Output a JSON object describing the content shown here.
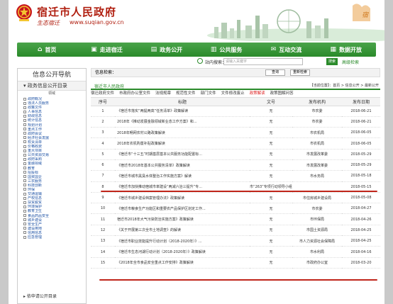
{
  "header": {
    "site_title": "宿迁市人民政府",
    "slogan": "生态宿迁",
    "url": "www.suqian.gov.cn"
  },
  "nav": [
    {
      "label": "首页",
      "icon": "home-icon"
    },
    {
      "label": "走进宿迁",
      "icon": "screen-icon"
    },
    {
      "label": "政务公开",
      "icon": "document-icon"
    },
    {
      "label": "公共服务",
      "icon": "service-icon"
    },
    {
      "label": "互动交流",
      "icon": "chat-icon"
    },
    {
      "label": "数据开放",
      "icon": "data-icon"
    }
  ],
  "search": {
    "label": "站内搜索：",
    "placeholder": "请输入关键字",
    "button": "搜索",
    "advanced": "高级检索"
  },
  "left": {
    "title": "信息公开导航",
    "category": "政务信息公开目录",
    "sub_header": "领域",
    "items": [
      "政府概况",
      "违法人员服务",
      "政策文件",
      "人事信息",
      "财政信息",
      "统计信息",
      "规划计划",
      "重点工作",
      "政府会议",
      "经济社会发展",
      "权责清单",
      "价格收费",
      "重大项目",
      "公共资源交易",
      "政府采购",
      "金融领域",
      "教育",
      "招投标",
      "国资国企",
      "三农服务",
      "科技创新",
      "环保",
      "交通运输",
      "产权信息",
      "扶贫脱贫",
      "环境保护",
      "教育卫生",
      "食品药品安全",
      "城乡建设",
      "安全生产",
      "建设用地",
      "信用信息",
      "应急管理"
    ],
    "category2": "依申请公开目录"
  },
  "right": {
    "retrieval_label": "信息检索：",
    "query_button": "查询",
    "reset_button": "重新检索",
    "tab_title": "宿迁市人民政府",
    "breadcrumb": "【当前位置】：首页 > 信息公开 > 最新公开",
    "tabs": [
      "宿迁政府文件",
      "市政府办公室文件",
      "法规规章",
      "规范性文件",
      "部门文件",
      "文件修改废止",
      "政策解读",
      "政策图解问答"
    ],
    "active_tab_index": 6,
    "columns": [
      "序号",
      "标题",
      "文号",
      "发布机构",
      "发布日期"
    ],
    "rows": [
      [
        "1",
        "《宿迁市落实“两提两高”任务清单》政策解读",
        "无",
        "市农委",
        "2018-06-21"
      ],
      [
        "2",
        "2018年《推动发展金融领域新业态工作方案》和...",
        "无",
        "市农委",
        "2018-06-21"
      ],
      [
        "3",
        "2018年畅网农村公路政策解读",
        "无",
        "市农机局",
        "2018-06-05"
      ],
      [
        "4",
        "2018年农机购置补贴政策解读",
        "无",
        "市农机局",
        "2018-06-05"
      ],
      [
        "5",
        "《宿迁市“十三五”时期基层基本公共服务功能配置标...",
        "无",
        "市发展改革委",
        "2018-05-29"
      ],
      [
        "6",
        "《宿迁市2018年基本公共服务清单》政策解读",
        "无",
        "市发展改革委",
        "2018-05-29"
      ],
      [
        "7",
        "《宿迁市城市黑臭水体整治工作实施方案》解读",
        "无",
        "市水务局",
        "2018-05-18"
      ],
      [
        "8",
        "《宿迁市加快推动宿城市率建设“两减六治三提升”专...",
        "市“263”专项行动领导小组办公室",
        "",
        "2018-05-15"
      ],
      [
        "9",
        "《宿迁市城乡建设档案管理办法》政策解读",
        "无",
        "市住房城乡建设局",
        "2018-05-08"
      ],
      [
        "10",
        "《宿迁市粮食生产功能区和重要农产品保护区划定工作...",
        "无",
        "市农委",
        "2018-04-27"
      ],
      [
        "11",
        "宿迁市2018年大气污染防治实施方案》政策解读",
        "无",
        "市环保局",
        "2018-04-26"
      ],
      [
        "12",
        "《关于开展第三次全市土地调查》的解读",
        "无",
        "市国土资源局",
        "2018-04-25"
      ],
      [
        "13",
        "《宿迁市职业技能提升行动计划（2018-2020年）》...",
        "无",
        "市人力资源社会保障局",
        "2018-04-25"
      ],
      [
        "14",
        "《宿迁市生态河湖行动计划（2018-2020年）》政策解读",
        "无",
        "市水利局",
        "2018-04-16"
      ],
      [
        "15",
        "《2018年全市食品安全重点工作安排》政策解读",
        "无",
        "市政府办公室",
        "2018-03-20"
      ]
    ]
  }
}
